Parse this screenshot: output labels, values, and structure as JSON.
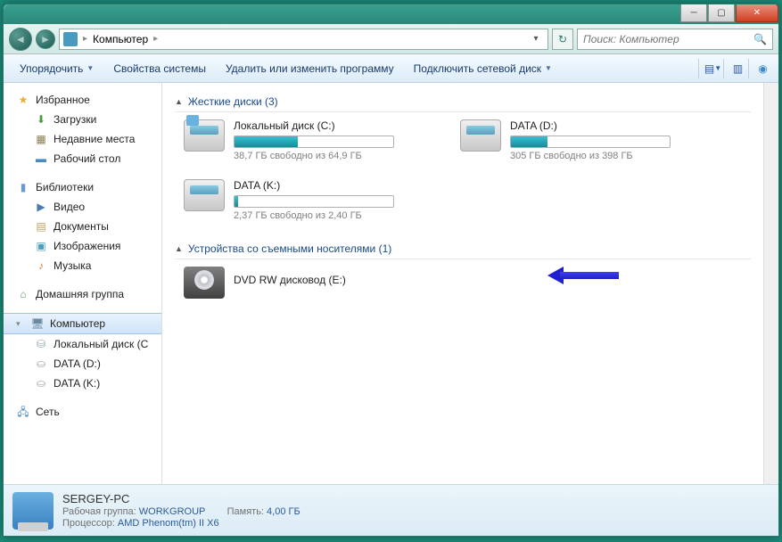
{
  "breadcrumb": {
    "root": "Компьютер"
  },
  "search": {
    "placeholder": "Поиск: Компьютер"
  },
  "toolbar": {
    "organize": "Упорядочить",
    "properties": "Свойства системы",
    "uninstall": "Удалить или изменить программу",
    "mapdrive": "Подключить сетевой диск"
  },
  "sidebar": {
    "favorites": "Избранное",
    "downloads": "Загрузки",
    "recent": "Недавние места",
    "desktop": "Рабочий стол",
    "libraries": "Библиотеки",
    "videos": "Видео",
    "documents": "Документы",
    "pictures": "Изображения",
    "music": "Музыка",
    "homegroup": "Домашняя группа",
    "computer": "Компьютер",
    "localc": "Локальный диск (C",
    "datad": "DATA (D:)",
    "datak": "DATA (K:)",
    "network": "Сеть"
  },
  "sections": {
    "hdd": "Жесткие диски (3)",
    "removable": "Устройства со съемными носителями (1)"
  },
  "drives": {
    "c": {
      "name": "Локальный диск (C:)",
      "info": "38,7 ГБ свободно из 64,9 ГБ",
      "pct": 40
    },
    "d": {
      "name": "DATA (D:)",
      "info": "305 ГБ свободно из 398 ГБ",
      "pct": 23
    },
    "k": {
      "name": "DATA (K:)",
      "info": "2,37 ГБ свободно из 2,40 ГБ",
      "pct": 2
    },
    "dvd": {
      "name": "DVD RW дисковод (E:)"
    }
  },
  "details": {
    "name": "SERGEY-PC",
    "workgroup_lbl": "Рабочая группа:",
    "workgroup": "WORKGROUP",
    "memory_lbl": "Память:",
    "memory": "4,00 ГБ",
    "cpu_lbl": "Процессор:",
    "cpu": "AMD Phenom(tm) II X6"
  }
}
